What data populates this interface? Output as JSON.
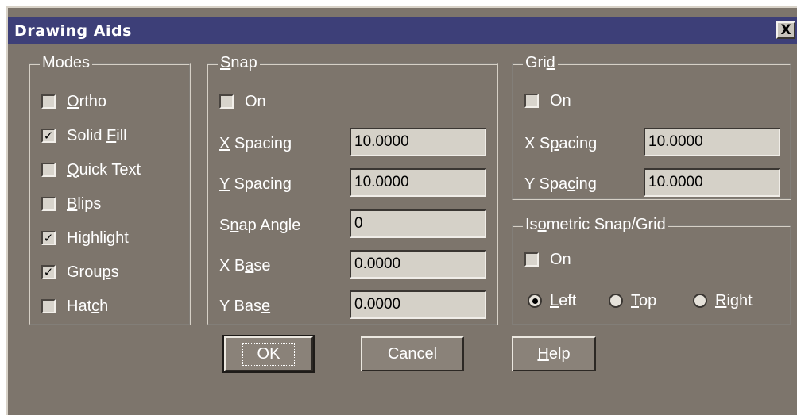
{
  "window": {
    "title": "Drawing Aids",
    "close_glyph": "X"
  },
  "modes": {
    "legend": "Modes",
    "items": [
      {
        "pre": "",
        "u": "O",
        "post": "rtho",
        "checked": false
      },
      {
        "pre": "Solid ",
        "u": "F",
        "post": "ill",
        "checked": true
      },
      {
        "pre": "",
        "u": "Q",
        "post": "uick Text",
        "checked": false
      },
      {
        "pre": "",
        "u": "B",
        "post": "lips",
        "checked": false
      },
      {
        "pre": "Highli",
        "u": "g",
        "post": "ht",
        "checked": true
      },
      {
        "pre": "Grou",
        "u": "p",
        "post": "s",
        "checked": true
      },
      {
        "pre": "Hat",
        "u": "c",
        "post": "h",
        "checked": false
      }
    ]
  },
  "snap": {
    "legend_u": "S",
    "legend_rest": "nap",
    "on": {
      "label": "On",
      "checked": false
    },
    "x_spacing": {
      "u": "X",
      "rest": " Spacing",
      "value": "10.0000"
    },
    "y_spacing": {
      "u": "Y",
      "rest": " Spacing",
      "value": "10.0000"
    },
    "snap_angle": {
      "pre": "S",
      "u": "n",
      "post": "ap Angle",
      "value": "0"
    },
    "x_base": {
      "pre": "X B",
      "u": "a",
      "post": "se",
      "value": "0.0000"
    },
    "y_base": {
      "pre": "Y Bas",
      "u": "e",
      "post": "",
      "value": "0.0000"
    }
  },
  "grid": {
    "legend_pre": "Gri",
    "legend_u": "d",
    "on": {
      "label": "On",
      "checked": false
    },
    "x_spacing": {
      "pre": "X S",
      "u": "p",
      "post": "acing",
      "value": "10.0000"
    },
    "y_spacing": {
      "pre": "Y Spa",
      "u": "c",
      "post": "ing",
      "value": "10.0000"
    }
  },
  "isometric": {
    "legend_pre": "Is",
    "legend_u": "o",
    "legend_post": "metric Snap/Grid",
    "on": {
      "label": "On",
      "checked": false
    },
    "radios": [
      {
        "u": "L",
        "rest": "eft",
        "selected": true
      },
      {
        "u": "T",
        "rest": "op",
        "selected": false
      },
      {
        "u": "R",
        "rest": "ight",
        "selected": false
      }
    ]
  },
  "buttons": {
    "ok": "OK",
    "cancel": "Cancel",
    "help_u": "H",
    "help_rest": "elp"
  },
  "icons": {
    "check": "check-mark-icon",
    "close": "close-icon",
    "radio": "radio-dot-icon"
  }
}
